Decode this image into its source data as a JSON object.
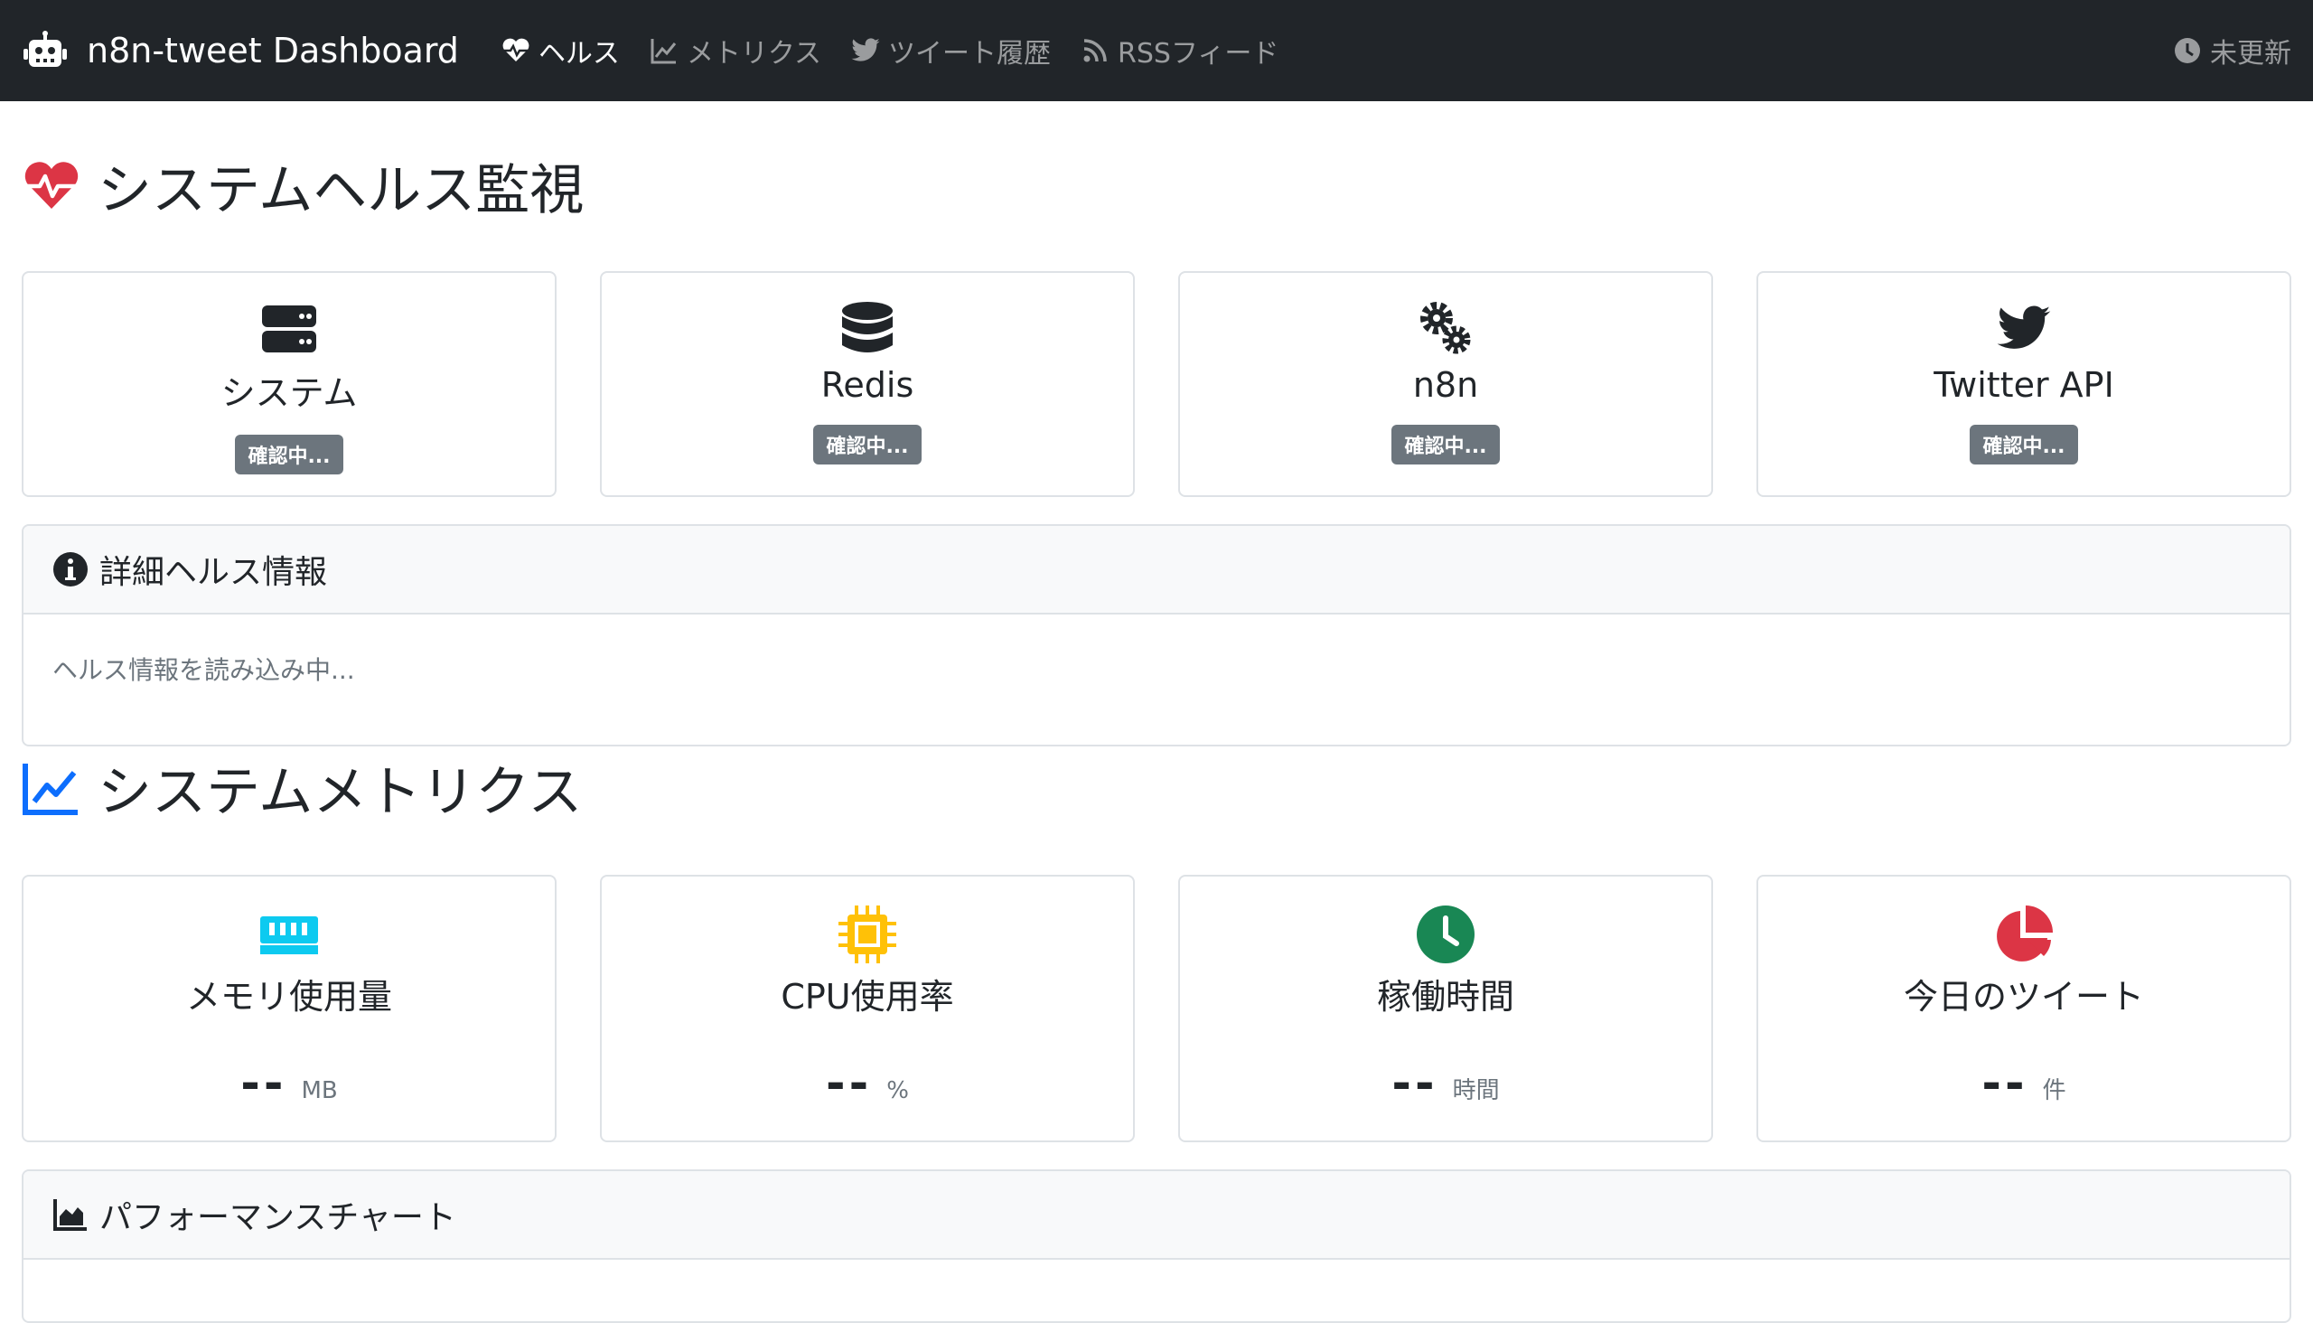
{
  "navbar": {
    "brand": "n8n-tweet Dashboard",
    "links": [
      {
        "label": "ヘルス",
        "icon": "heartbeat-icon",
        "active": true
      },
      {
        "label": "メトリクス",
        "icon": "chart-line-icon",
        "active": false
      },
      {
        "label": "ツイート履歴",
        "icon": "twitter-icon",
        "active": false
      },
      {
        "label": "RSSフィード",
        "icon": "rss-icon",
        "active": false
      }
    ],
    "last_updated": "未更新"
  },
  "health": {
    "title": "システムヘルス監視",
    "cards": [
      {
        "title": "システム",
        "status": "確認中...",
        "icon": "server-icon"
      },
      {
        "title": "Redis",
        "status": "確認中...",
        "icon": "database-icon"
      },
      {
        "title": "n8n",
        "status": "確認中...",
        "icon": "cogs-icon"
      },
      {
        "title": "Twitter API",
        "status": "確認中...",
        "icon": "twitter-icon"
      }
    ],
    "detail": {
      "title": "詳細ヘルス情報",
      "body": "ヘルス情報を読み込み中..."
    }
  },
  "metrics": {
    "title": "システムメトリクス",
    "cards": [
      {
        "title": "メモリ使用量",
        "value": "--",
        "unit": "MB",
        "icon": "memory-icon",
        "color": "#0dcaf0"
      },
      {
        "title": "CPU使用率",
        "value": "--",
        "unit": "%",
        "icon": "microchip-icon",
        "color": "#ffc107"
      },
      {
        "title": "稼働時間",
        "value": "--",
        "unit": "時間",
        "icon": "clock-icon",
        "color": "#198754"
      },
      {
        "title": "今日のツイート",
        "value": "--",
        "unit": "件",
        "icon": "pie-chart-icon",
        "color": "#dc3545"
      }
    ],
    "performance": {
      "title": "パフォーマンスチャート"
    }
  },
  "colors": {
    "navbar_bg": "#212529",
    "badge_secondary": "#6c757d",
    "heart": "#dc3545",
    "chart_title": "#0d6efd"
  }
}
